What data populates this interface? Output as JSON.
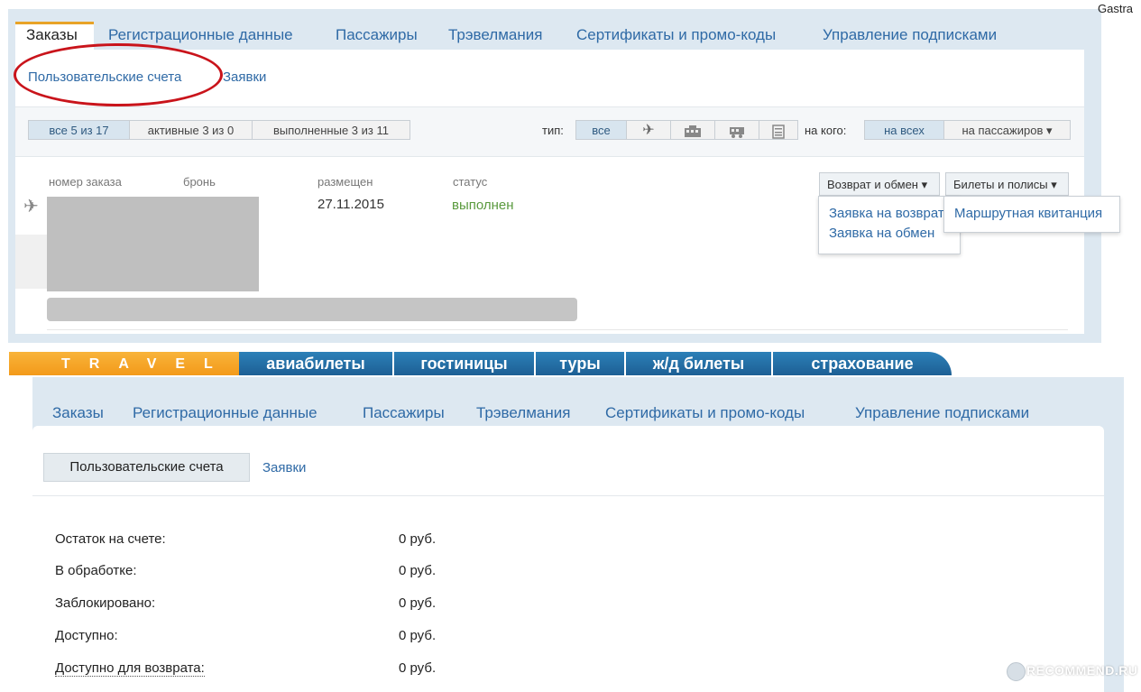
{
  "corner_text": "Gastra",
  "top": {
    "tabs": [
      "Заказы",
      "Регистрационные данные",
      "Пассажиры",
      "Трэвелмания",
      "Сертификаты и промо-коды",
      "Управление подписками"
    ],
    "subtabs": [
      "Пользовательские счета",
      "Заявки"
    ],
    "filters": {
      "status": [
        "все 5 из 17",
        "активные 3 из 0",
        "выполненные 3 из 11"
      ],
      "type_label": "тип:",
      "type_all": "все",
      "who_label": "на кого:",
      "who_all": "на всех",
      "who_passengers": "на пассажиров ▾"
    },
    "columns": [
      "номер заказа",
      "бронь",
      "размещен",
      "статус"
    ],
    "order": {
      "date": "27.11.2015",
      "status": "выполнен"
    },
    "dropdowns": {
      "return": "Возврат и обмен ▾",
      "tickets": "Билеты и полисы ▾"
    },
    "return_menu": [
      "Заявка на возврат",
      "Заявка на обмен"
    ],
    "tickets_menu": [
      "Маршрутная квитанция"
    ]
  },
  "travel_bar": {
    "logo": "TRAVEL",
    "tabs": [
      "авиабилеты",
      "гостиницы",
      "туры",
      "ж/д билеты",
      "страхование"
    ]
  },
  "bottom": {
    "tabs": [
      "Заказы",
      "Регистрационные данные",
      "Пассажиры",
      "Трэвелмания",
      "Сертификаты и промо-коды",
      "Управление подписками"
    ],
    "subtabs": [
      "Пользовательские счета",
      "Заявки"
    ],
    "balance": [
      {
        "label": "Остаток на счете:",
        "value": "0 руб."
      },
      {
        "label": "В обработке:",
        "value": "0 руб."
      },
      {
        "label": "Заблокировано:",
        "value": "0 руб."
      },
      {
        "label": "Доступно:",
        "value": "0 руб."
      },
      {
        "label": "Доступно для возврата:",
        "value": "0 руб."
      }
    ]
  },
  "watermark": "RECOMMEND.RU",
  "colors": {
    "link": "#2f6aa6",
    "highlight_oval": "#c9141b",
    "accent_tab": "#e8a327",
    "nav": "#2c80b8"
  }
}
